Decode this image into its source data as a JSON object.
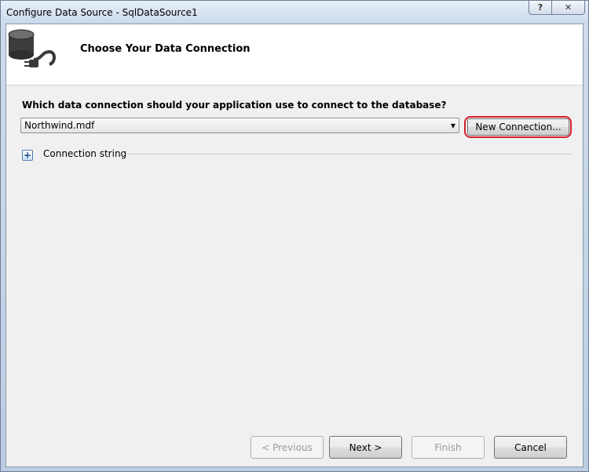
{
  "window": {
    "title": "Configure Data Source - SqlDataSource1",
    "help_label": "?",
    "close_label": "✕"
  },
  "header": {
    "icon": "database-connection-icon",
    "title": "Choose Your Data Connection"
  },
  "main": {
    "question": "Which data connection should your application use to connect to the database?",
    "connection_select": {
      "value": "Northwind.mdf"
    },
    "new_connection_label": "New Connection...",
    "connection_string_label": "Connection string",
    "expander_label": "+"
  },
  "footer": {
    "previous_label": "< Previous",
    "next_label": "Next >",
    "finish_label": "Finish",
    "cancel_label": "Cancel"
  },
  "colors": {
    "highlight": "#d61f2b"
  }
}
